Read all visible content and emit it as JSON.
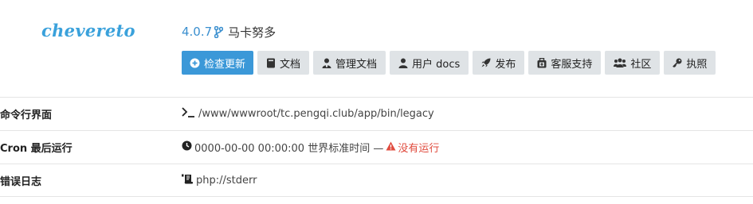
{
  "logo": {
    "text": "chevereto"
  },
  "version": {
    "number": "4.0.7",
    "name": "马卡努多"
  },
  "buttons": [
    {
      "label": "检查更新",
      "icon": "plus-circle-icon",
      "primary": true
    },
    {
      "label": "文档",
      "icon": "book-icon"
    },
    {
      "label": "管理文档",
      "icon": "admin-user-icon"
    },
    {
      "label": "用户 docs",
      "icon": "user-icon"
    },
    {
      "label": "发布",
      "icon": "rocket-icon"
    },
    {
      "label": "客服支持",
      "icon": "support-icon"
    },
    {
      "label": "社区",
      "icon": "users-icon"
    },
    {
      "label": "执照",
      "icon": "key-icon"
    }
  ],
  "rows": [
    {
      "label": "命令行界面",
      "value": "/www/wwwroot/tc.pengqi.club/app/bin/legacy",
      "icon": "terminal-icon"
    },
    {
      "label": "Cron 最后运行",
      "value": "0000-00-00 00:00:00 世界标准时间 —",
      "icon": "clock-icon",
      "warning": "没有运行"
    },
    {
      "label": "错误日志",
      "value": "php://stderr",
      "icon": "log-icon"
    }
  ],
  "colors": {
    "accent": "#3b98d8",
    "button_bg": "#dfe3e6",
    "warning": "#e04b3e"
  }
}
